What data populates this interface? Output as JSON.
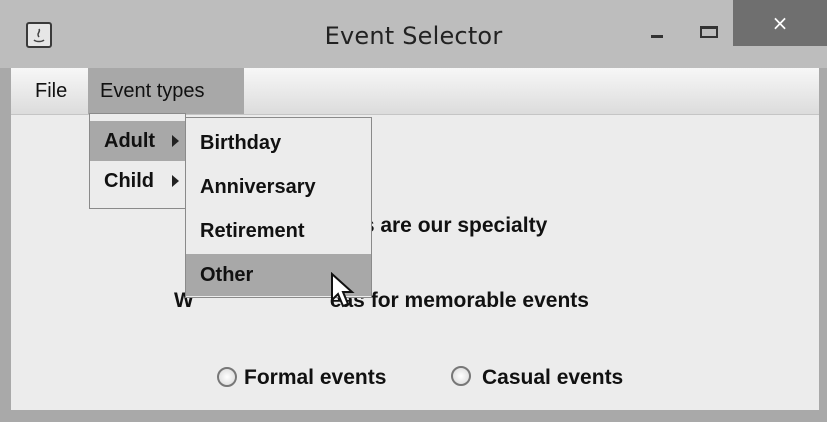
{
  "window": {
    "title": "Event Selector",
    "close_label": "×"
  },
  "menubar": {
    "file": "File",
    "event_types": "Event types"
  },
  "event_types_menu": {
    "items": [
      {
        "label": "Adult",
        "has_submenu": true,
        "highlighted": true
      },
      {
        "label": "Child",
        "has_submenu": true,
        "highlighted": false
      }
    ]
  },
  "adult_submenu": {
    "items": [
      {
        "label": "Birthday"
      },
      {
        "label": "Anniversary"
      },
      {
        "label": "Retirement"
      },
      {
        "label": "Other",
        "highlighted": true
      }
    ]
  },
  "content": {
    "line1_visible": "nts are our specialty",
    "line2_prefix": "W",
    "line2_visible": "eas for memorable events"
  },
  "radios": [
    {
      "label": "Formal events",
      "checked": false
    },
    {
      "label": "Casual events",
      "checked": false
    }
  ]
}
